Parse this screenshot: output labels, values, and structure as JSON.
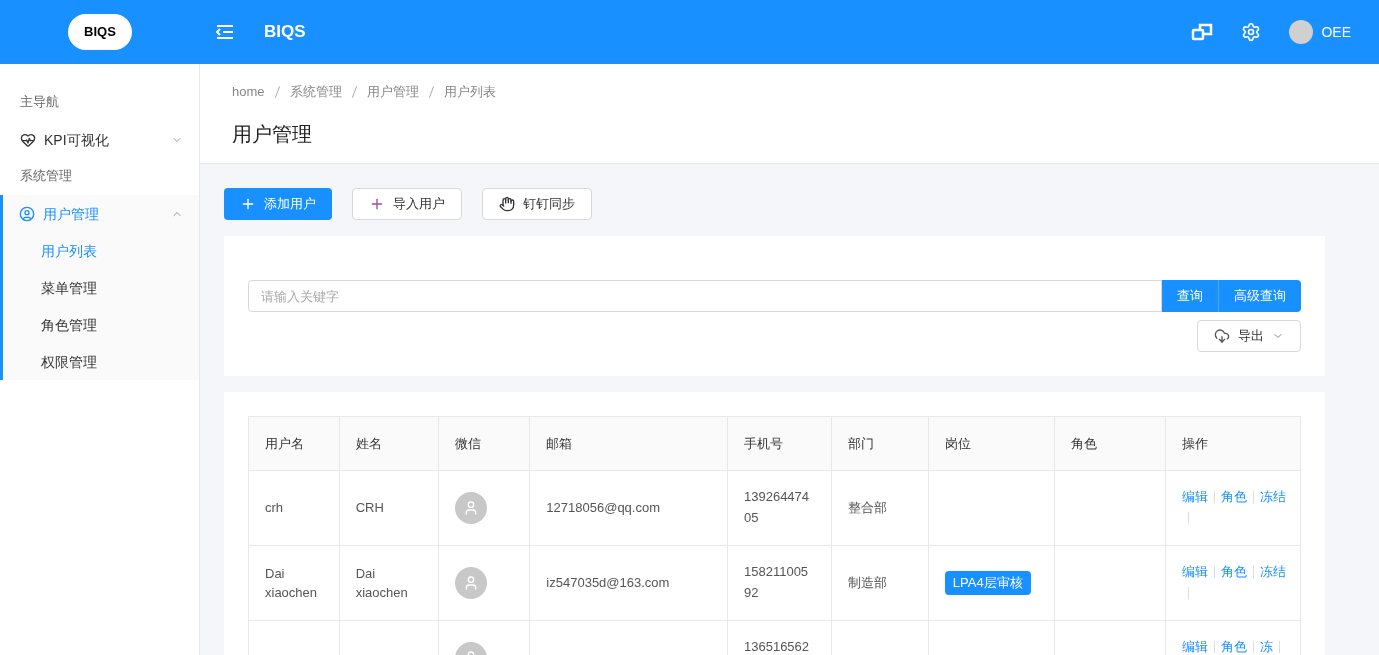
{
  "header": {
    "logo_text": "BIQS",
    "title": "BIQS",
    "user": "OEE"
  },
  "sidebar": {
    "sections": [
      {
        "label": "主导航",
        "items": [
          {
            "label": "KPI可视化",
            "kind": "heart",
            "expanded": false,
            "selected": false
          }
        ]
      },
      {
        "label": "系统管理",
        "items": [
          {
            "label": "用户管理",
            "kind": "user",
            "expanded": true,
            "selected": true,
            "children": [
              {
                "label": "用户列表",
                "selected": true
              },
              {
                "label": "菜单管理",
                "selected": false
              },
              {
                "label": "角色管理",
                "selected": false
              },
              {
                "label": "权限管理",
                "selected": false
              }
            ]
          }
        ]
      }
    ]
  },
  "breadcrumb": [
    "home",
    "系统管理",
    "用户管理",
    "用户列表"
  ],
  "page_title": "用户管理",
  "toolbar": [
    {
      "label": "添加用户",
      "kind": "primary"
    },
    {
      "label": "导入用户",
      "kind": "plus"
    },
    {
      "label": "钉钉同步",
      "kind": "sync"
    }
  ],
  "search": {
    "placeholder": "请输入关键字",
    "buttons": [
      "查询",
      "高级查询"
    ],
    "export": "导出"
  },
  "table": {
    "columns": [
      "用户名",
      "姓名",
      "微信",
      "邮箱",
      "手机号",
      "部门",
      "岗位",
      "角色",
      "操作"
    ],
    "rows": [
      {
        "username": "crh",
        "name": "CRH",
        "email": "12718056@qq.com",
        "phone": "139264474 05",
        "department": "整合部",
        "positions": [],
        "actions": [
          "编辑",
          "角色",
          "冻结"
        ]
      },
      {
        "username": "Dai xiaochen",
        "name": "Dai xiaochen",
        "email": "iz547035d@163.com",
        "phone": "158211005 92",
        "department": "制造部",
        "positions": [
          "LPA4层审核"
        ],
        "actions": [
          "编辑",
          "角色",
          "冻结"
        ]
      },
      {
        "username": "",
        "name": "",
        "email": "",
        "phone": "136516562",
        "department": "",
        "positions": [],
        "actions": [
          "编辑",
          "角色",
          "冻"
        ]
      }
    ]
  }
}
